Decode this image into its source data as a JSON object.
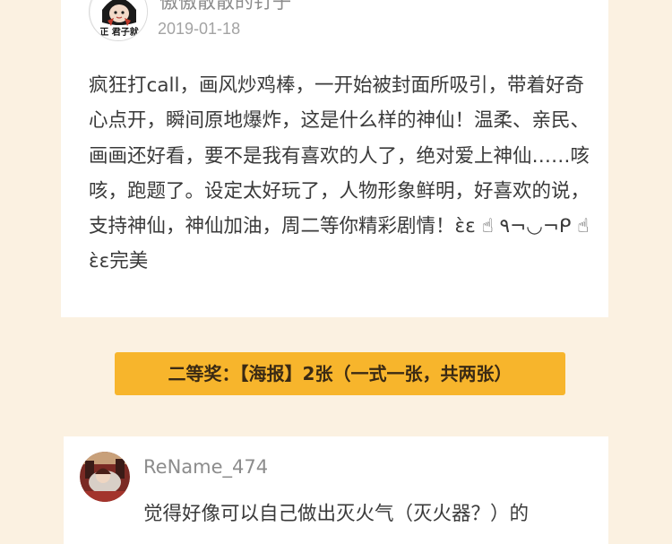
{
  "posts": [
    {
      "username": "傲傲散散的钉子",
      "date": "2019-01-18",
      "comment": "疯狂打call，画风炒鸡棒，一开始被封面所吸引，带着好奇心点开，瞬间原地爆炸，这是什么样的神仙！温柔、亲民、画画还好看，要不是我有喜欢的人了，绝对爱上神仙……咳咳，跑题了。设定太好玩了，人物形象鲜明，好喜欢的说，支持神仙，神仙加油，周二等你精彩剧情！ɛ̀ɛ ☝ ٩¬◡¬ᑭ ☝ ɛ̀ɛ完美",
      "avatar_badge": "正 君子就"
    },
    {
      "username": "ReName_474",
      "comment": "觉得好像可以自己做出灭火气（灭火器？）的"
    }
  ],
  "prize": {
    "label": "二等奖：【海报】2张（一式一张，共两张）"
  },
  "colors": {
    "page_background": "#fbf1e1",
    "card_background": "#ffffff",
    "banner_background": "#f7b52c"
  }
}
